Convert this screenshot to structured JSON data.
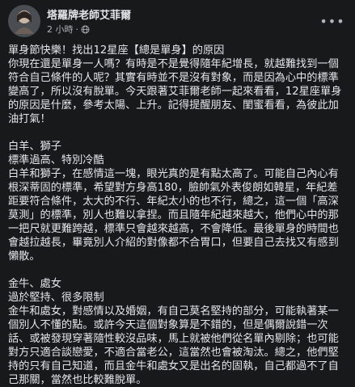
{
  "author": {
    "name": "塔羅牌老師艾菲爾",
    "timestamp": "2 小時",
    "privacy_icon": "globe-icon"
  },
  "post": {
    "paragraphs": [
      {
        "lines": [
          "單身節快樂！找出12星座【總是單身】的原因",
          "你現在還是單身一人嗎？有時是不是覺得隨年紀增長，就越難找到一個",
          "符合自己條件的人呢？其實有時並不是沒有對象，而是因為心中的標準",
          "變高了，所以沒有脫單。今天跟著艾菲爾老師一起來看看，12星座單身",
          "的原因是什麼，參考太陽、上升。記得提醒朋友、閨蜜看看，為彼此加",
          "油打氣！"
        ]
      },
      {
        "lines": [
          "白羊、獅子",
          "標準過高、特別冷酷",
          "白羊和獅子，在感情這一塊，眼光真的是有點太高了。可能自己內心有",
          "根深蒂固的標準，希望對方身高180，臉帥氣外表俊朗如韓星，年紀差",
          "距要符合條件，太大的不行、年紀太小的也不行，總之，這一個「高深",
          "莫測」的標準，別人也難以拿捏。而且隨年紀越來越大，他們心中的那",
          "一把尺就更難跨越，標準只會越來越高，不會降低。最後單身的時間也",
          "會越拉越長，畢竟別人介紹的對像都不合胃口，但要自己去找又有感到",
          "懶散。"
        ]
      },
      {
        "lines": [
          "金牛、處女",
          "過於堅持、很多限制",
          "金牛和處女，對感情以及婚姻，有自己莫名堅持的部分，可能執著某一",
          "個別人不懂的點。或許今天這個對象算是不錯的，但是偶爾說錯一次",
          "話、或被發現穿著隨性較沒品味，馬上就被他們從名單內剔除；也可能",
          "對方只適合談戀愛，不適合當老公，這當然也會被淘汰。總之，他們堅",
          "持的只有自己知道，而且金牛和處女又是出名的固執，自己都過不了自",
          "己那關，當然也比較難脫單。"
        ]
      }
    ]
  }
}
